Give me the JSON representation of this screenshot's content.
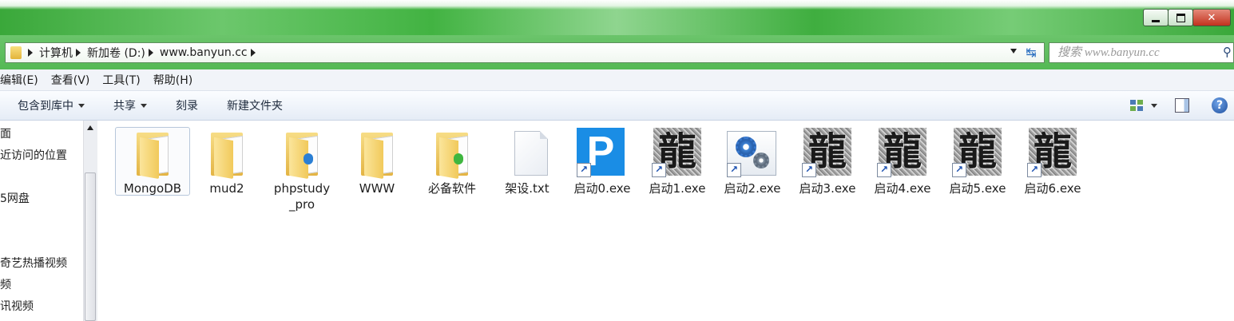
{
  "window": {
    "minimize_glyph": "",
    "maximize_glyph": "",
    "close_glyph": "✕"
  },
  "address": {
    "crumbs": [
      "计算机",
      "新加卷 (D:)",
      "www.banyun.cc"
    ]
  },
  "search": {
    "placeholder": "搜索 www.banyun.cc"
  },
  "menu": [
    "编辑(E)",
    "查看(V)",
    "工具(T)",
    "帮助(H)"
  ],
  "toolbar": {
    "include_library": "包含到库中",
    "share": "共享",
    "burn": "刻录",
    "new_folder": "新建文件夹",
    "help_glyph": "?"
  },
  "nav": {
    "items": [
      "面",
      "近访问的位置",
      "5网盘",
      "奇艺热播视频",
      "频",
      "讯视频"
    ]
  },
  "files": [
    {
      "name": "MongoDB",
      "kind": "folder",
      "icon": "folder-icon",
      "selected": true
    },
    {
      "name": "mud2",
      "kind": "folder",
      "icon": "folder-icon"
    },
    {
      "name": "phpstudy_pro",
      "kind": "folder",
      "icon": "folder-icon"
    },
    {
      "name": "WWW",
      "kind": "folder",
      "icon": "folder-icon"
    },
    {
      "name": "必备软件",
      "kind": "folder",
      "icon": "folder-icon"
    },
    {
      "name": "架设.txt",
      "kind": "text",
      "icon": "text-file-icon"
    },
    {
      "name": "启动0.exe",
      "kind": "exe-p",
      "icon": "p-app-icon",
      "shortcut": true
    },
    {
      "name": "启动1.exe",
      "kind": "exe-dragon",
      "icon": "dragon-app-icon",
      "shortcut": true
    },
    {
      "name": "启动2.exe",
      "kind": "exe-gears",
      "icon": "gears-app-icon",
      "shortcut": true
    },
    {
      "name": "启动3.exe",
      "kind": "exe-dragon",
      "icon": "dragon-app-icon",
      "shortcut": true
    },
    {
      "name": "启动4.exe",
      "kind": "exe-dragon",
      "icon": "dragon-app-icon",
      "shortcut": true
    },
    {
      "name": "启动5.exe",
      "kind": "exe-dragon",
      "icon": "dragon-app-icon",
      "shortcut": true
    },
    {
      "name": "启动6.exe",
      "kind": "exe-dragon",
      "icon": "dragon-app-icon",
      "shortcut": true
    }
  ],
  "icon_glyphs": {
    "p_letter": "P",
    "dragon_char": "龍",
    "shortcut_arrow": "↗"
  },
  "colors": {
    "title_green": "#3aa83a",
    "p_blue": "#1a8de5",
    "folder_yellow": "#f1c95a"
  }
}
